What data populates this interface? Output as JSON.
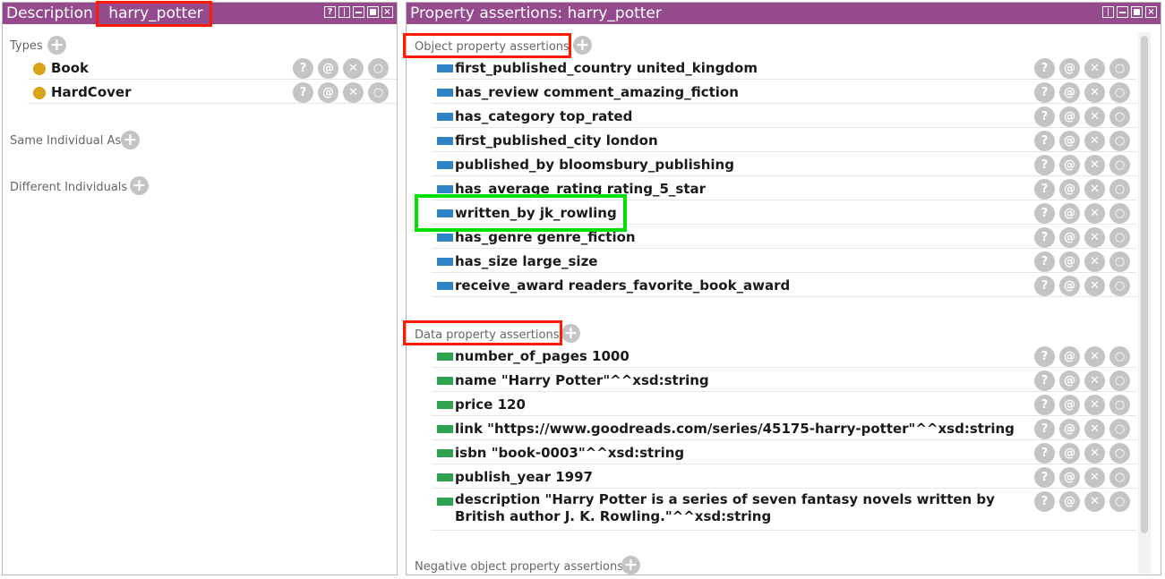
{
  "description_panel": {
    "title": "Description",
    "individual": "harry_potter",
    "types_label": "Types",
    "types": [
      {
        "label": "Book"
      },
      {
        "label": "HardCover"
      }
    ],
    "same_individual_label": "Same Individual As",
    "different_individuals_label": "Different Individuals"
  },
  "assertions_panel": {
    "title": "Property assertions: harry_potter",
    "object_section_label": "Object property assertions",
    "object_assertions": [
      {
        "text": "first_published_country  united_kingdom"
      },
      {
        "text": "has_review  comment_amazing_fiction"
      },
      {
        "text": "has_category  top_rated"
      },
      {
        "text": "first_published_city  london"
      },
      {
        "text": "published_by  bloomsbury_publishing"
      },
      {
        "text": "has_average_rating  rating_5_star"
      },
      {
        "text": "written_by  jk_rowling"
      },
      {
        "text": "has_genre  genre_fiction"
      },
      {
        "text": "has_size  large_size"
      },
      {
        "text": "receive_award  readers_favorite_book_award"
      }
    ],
    "data_section_label": "Data property assertions",
    "data_assertions": [
      {
        "text": "number_of_pages  1000"
      },
      {
        "text": "name  \"Harry Potter\"^^xsd:string"
      },
      {
        "text": "price  120"
      },
      {
        "text": "link  \"https://www.goodreads.com/series/45175-harry-potter\"^^xsd:string"
      },
      {
        "text": "isbn  \"book-0003\"^^xsd:string"
      },
      {
        "text": "publish_year  1997"
      },
      {
        "text": "description  \"Harry Potter is a series of seven fantasy novels written by British author J. K. Rowling.\"^^xsd:string"
      }
    ],
    "negative_object_label": "Negative object property assertions"
  },
  "action_icons": {
    "help": "?",
    "annotate": "@",
    "delete": "✕",
    "edit": "○"
  },
  "colors": {
    "titlebar": "#944a8d",
    "highlight_red": "#ff1a00",
    "highlight_green": "#00e000",
    "object_chip": "#2f82c4",
    "data_chip": "#2da34f",
    "class_dot": "#d9a418"
  }
}
